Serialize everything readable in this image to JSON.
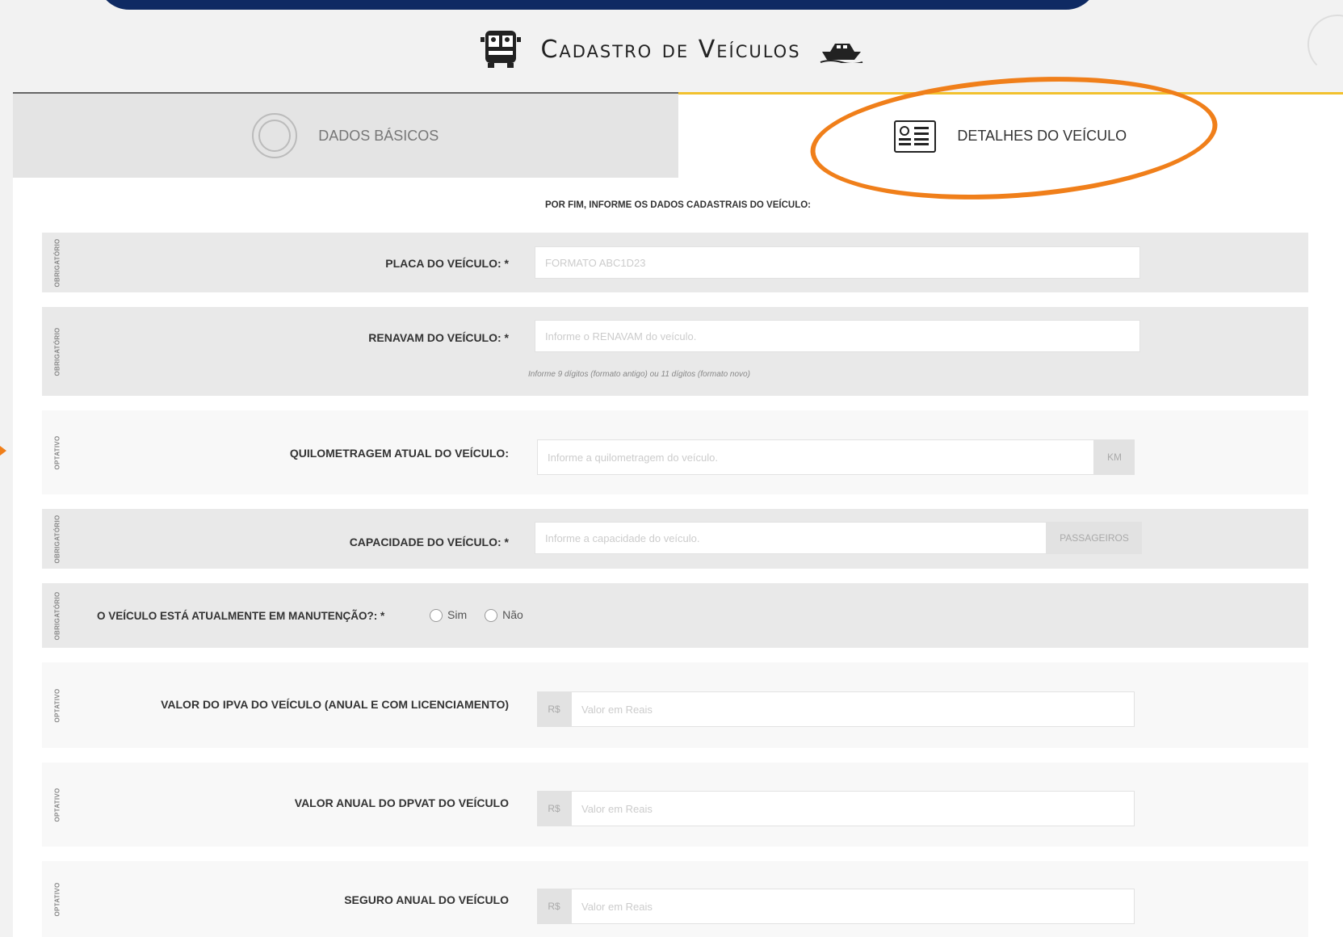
{
  "header": {
    "title": "Cadastro de Veículos"
  },
  "tabs": [
    {
      "label": "DADOS BÁSICOS",
      "active": false
    },
    {
      "label": "DETALHES DO VEÍCULO",
      "active": true
    }
  ],
  "form": {
    "intro": "POR FIM, INFORME OS DADOS CADASTRAIS DO VEÍCULO:",
    "tags": {
      "required": "OBRIGATÓRIO",
      "optional": "OPTATIVO"
    },
    "placa": {
      "label": "PLACA DO VEÍCULO: *",
      "placeholder": "FORMATO ABC1D23"
    },
    "renavam": {
      "label": "RENAVAM DO VEÍCULO: *",
      "placeholder": "Informe o RENAVAM do veículo.",
      "hint": "Informe 9 dígitos (formato antigo) ou 11 dígitos (formato novo)"
    },
    "km": {
      "label": "QUILOMETRAGEM ATUAL DO VEÍCULO:",
      "placeholder": "Informe a quilometragem do veículo.",
      "unit": "KM"
    },
    "capacidade": {
      "label": "CAPACIDADE DO VEÍCULO: *",
      "placeholder": "Informe a capacidade do veículo.",
      "unit": "PASSAGEIROS"
    },
    "manutencao": {
      "label": "O VEÍCULO ESTÁ ATUALMENTE EM MANUTENÇÃO?: *",
      "options": [
        "Sim",
        "Não"
      ]
    },
    "ipva": {
      "label": "VALOR DO IPVA DO VEÍCULO (ANUAL E COM LICENCIAMENTO)",
      "prefix": "R$",
      "placeholder": "Valor em Reais"
    },
    "dpvat": {
      "label": "VALOR ANUAL DO DPVAT DO VEÍCULO",
      "prefix": "R$",
      "placeholder": "Valor em Reais"
    },
    "seguro": {
      "label": "SEGURO ANUAL DO VEÍCULO",
      "prefix": "R$",
      "placeholder": "Valor em Reais"
    }
  },
  "colors": {
    "banner": "#0f2a63",
    "accent": "#f2c12e",
    "highlight": "#f07f1a"
  }
}
